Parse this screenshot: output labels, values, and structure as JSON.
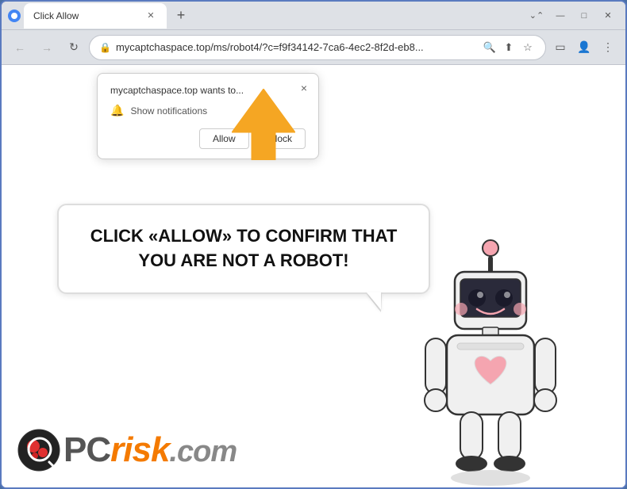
{
  "browser": {
    "title": "Click Allow",
    "tab_title": "Click Allow",
    "url": "mycaptchaspace.top/ms/robot4/?c=f9f34142-7ca6-4ec2-8f2d-eb8...",
    "new_tab_label": "+",
    "controls": {
      "minimize": "—",
      "maximize": "□",
      "close": "✕",
      "arrange": "❐"
    },
    "nav": {
      "back": "←",
      "forward": "→",
      "refresh": "↻"
    }
  },
  "notification_popup": {
    "title": "mycaptchaspace.top wants to...",
    "notification_label": "Show notifications",
    "allow_btn": "Allow",
    "block_btn": "Block",
    "close": "×"
  },
  "speech_bubble": {
    "text": "CLICK «ALLOW» TO CONFIRM THAT YOU ARE NOT A ROBOT!"
  },
  "logo": {
    "pc": "PC",
    "risk": "risk",
    "dot_com": ".com"
  },
  "icons": {
    "lock": "🔒",
    "search": "🔍",
    "share": "⬆",
    "star": "☆",
    "sidebar": "▭",
    "profile": "👤",
    "more": "⋮",
    "bell": "🔔",
    "extensions": "⊞",
    "chevron_down": "⌄"
  }
}
